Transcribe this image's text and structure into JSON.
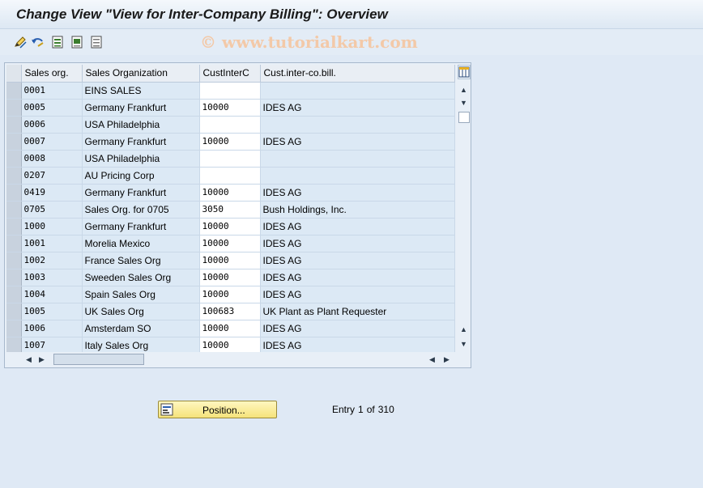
{
  "window": {
    "title": "Change View \"View for Inter-Company Billing\": Overview",
    "watermark": "© www.tutorialkart.com"
  },
  "toolbar": {
    "icons": [
      "edit-pencil-icon",
      "undo-icon",
      "select-all-icon",
      "select-block-icon",
      "deselect-all-icon"
    ]
  },
  "table": {
    "columns": [
      "Sales org.",
      "Sales Organization",
      "CustInterC",
      "Cust.inter-co.bill."
    ],
    "rows": [
      [
        "0001",
        "EINS SALES",
        "",
        ""
      ],
      [
        "0005",
        "Germany Frankfurt",
        "10000",
        "IDES AG"
      ],
      [
        "0006",
        "USA Philadelphia",
        "",
        ""
      ],
      [
        "0007",
        "Germany Frankfurt",
        "10000",
        "IDES AG"
      ],
      [
        "0008",
        "USA Philadelphia",
        "",
        ""
      ],
      [
        "0207",
        "AU Pricing Corp",
        "",
        ""
      ],
      [
        "0419",
        "Germany Frankfurt",
        "10000",
        "IDES AG"
      ],
      [
        "0705",
        "Sales Org. for 0705",
        "3050",
        "Bush Holdings, Inc."
      ],
      [
        "1000",
        "Germany Frankfurt",
        "10000",
        "IDES AG"
      ],
      [
        "1001",
        "Morelia Mexico",
        "10000",
        "IDES AG"
      ],
      [
        "1002",
        "France Sales Org",
        "10000",
        "IDES AG"
      ],
      [
        "1003",
        "Sweeden Sales Org",
        "10000",
        "IDES AG"
      ],
      [
        "1004",
        "Spain Sales Org",
        "10000",
        "IDES AG"
      ],
      [
        "1005",
        "UK Sales Org",
        "100683",
        "UK Plant as Plant Requester"
      ],
      [
        "1006",
        "Amsterdam SO",
        "10000",
        "IDES AG"
      ],
      [
        "1007",
        "Italy Sales Org",
        "10000",
        "IDES AG"
      ]
    ]
  },
  "footer": {
    "position_button": "Position...",
    "entry_label": "Entry",
    "entry_current": "1",
    "entry_of": "of",
    "entry_total": "310"
  },
  "colors": {
    "background": "#dfe9f5",
    "row": "#dce9f5",
    "input": "#ffffff",
    "button": "#f5e37a"
  }
}
